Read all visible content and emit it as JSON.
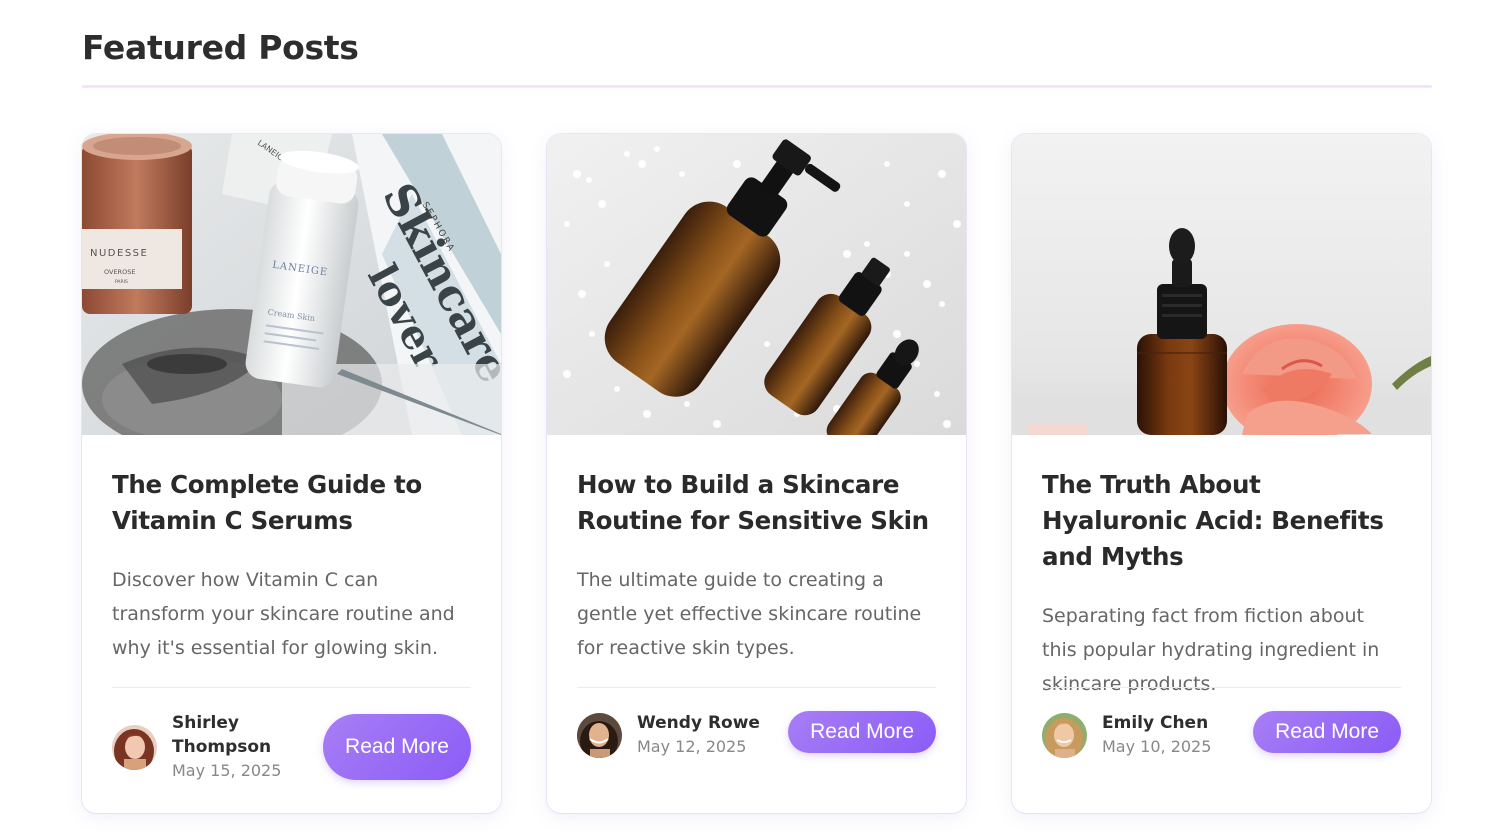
{
  "section": {
    "title": "Featured Posts"
  },
  "posts": [
    {
      "title": "The Complete Guide to Vitamin C Serums",
      "excerpt": "Discover how Vitamin C can transform your skincare routine and why it's essential for glowing skin.",
      "author": "Shirley Thompson",
      "date": "May 15, 2025",
      "button": "Read More",
      "image_text": [
        "NUDESSE",
        "OVEROSE",
        "PARIS",
        "LANEIGE",
        "Cream Skin",
        "Skincare",
        "lover",
        "SEPHORA",
        "LANEIGE"
      ]
    },
    {
      "title": "How to Build a Skincare Routine for Sensitive Skin",
      "excerpt": "The ultimate guide to creating a gentle yet effective skincare routine for reactive skin types.",
      "author": "Wendy Rowe",
      "date": "May 12, 2025",
      "button": "Read More"
    },
    {
      "title": "The Truth About Hyaluronic Acid: Benefits and Myths",
      "excerpt": "Separating fact from fiction about this popular hydrating ingredient in skincare products.",
      "author": "Emily Chen",
      "date": "May 10, 2025",
      "button": "Read More"
    }
  ],
  "colors": {
    "accent": "#8b5cf6",
    "accent_light": "#a87ef5",
    "rule": "#f3e3fb"
  },
  "icons": {
    "avatar": "author-avatar"
  }
}
